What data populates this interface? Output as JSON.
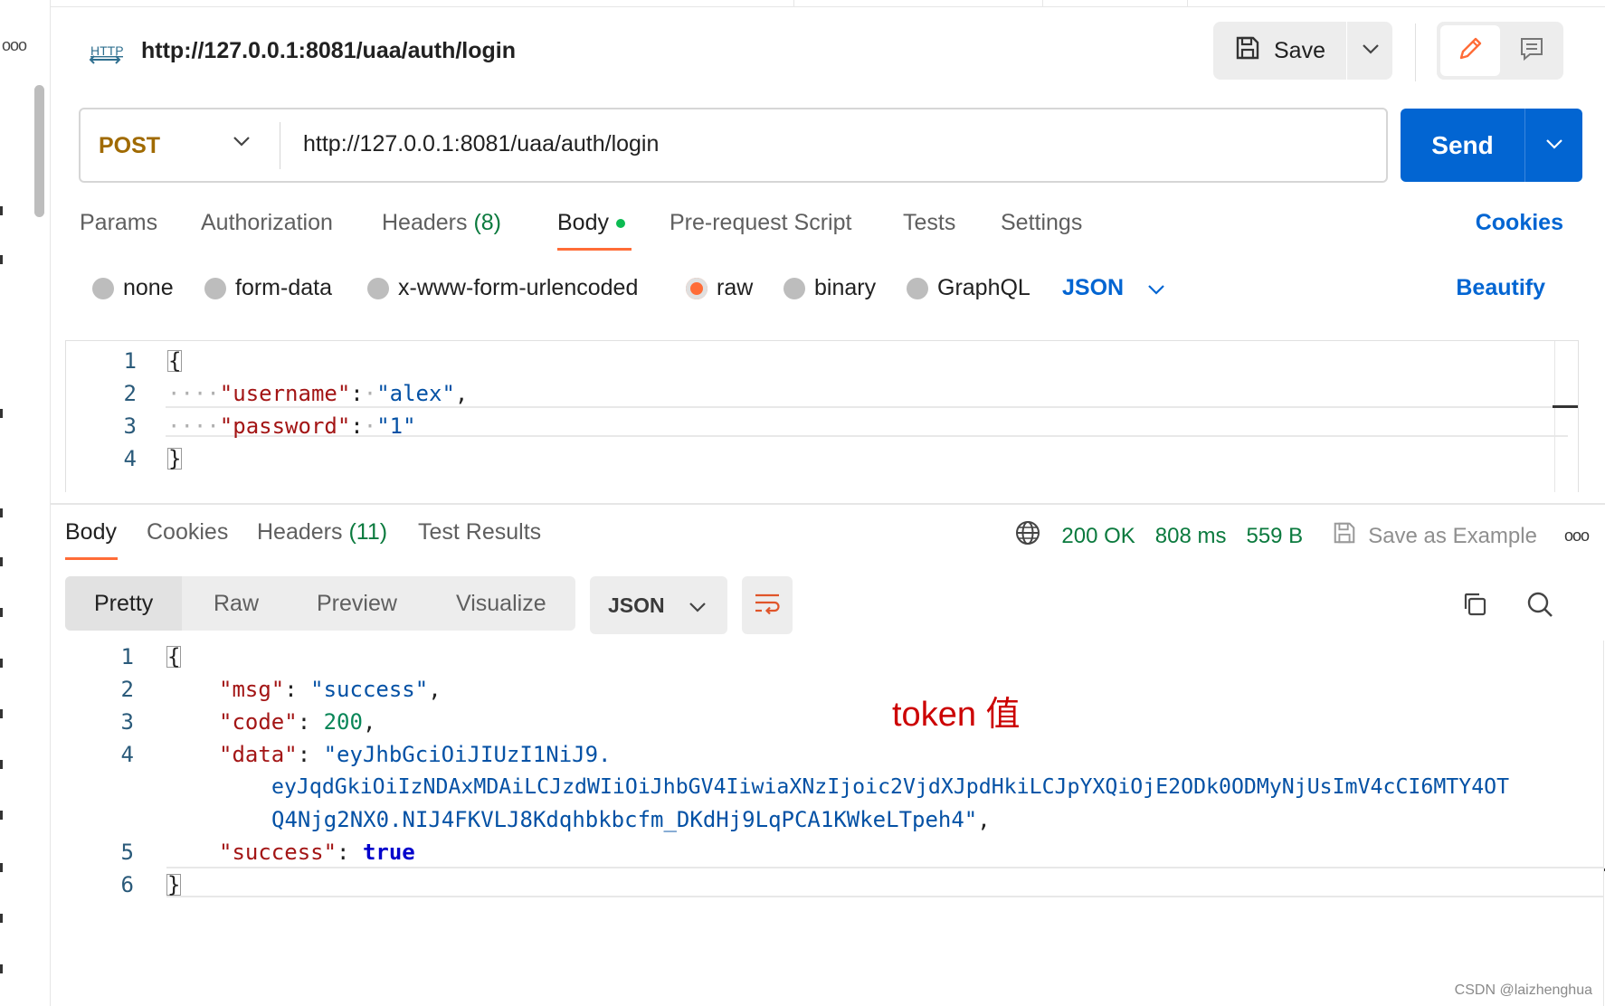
{
  "colors": {
    "accent_orange": "#ff6c37",
    "primary_blue": "#0265d2",
    "success_green": "#0b7a3e",
    "method_post": "#a06a00",
    "annotation_red": "#cc0000"
  },
  "sidebar": {
    "more_icon": "ellipsis-icon"
  },
  "header": {
    "protocol_icon": "http-icon",
    "title": "http://127.0.0.1:8081/uaa/auth/login",
    "save_label": "Save",
    "save_icon": "floppy-disk-icon",
    "edit_icon": "pencil-icon",
    "comment_icon": "comment-icon"
  },
  "request": {
    "method": "POST",
    "url": "http://127.0.0.1:8081/uaa/auth/login",
    "send_label": "Send"
  },
  "request_tabs": {
    "params": "Params",
    "authorization": "Authorization",
    "headers": "Headers",
    "headers_count": "(8)",
    "body": "Body",
    "pre_request": "Pre-request Script",
    "tests": "Tests",
    "settings": "Settings",
    "cookies": "Cookies"
  },
  "body_types": {
    "none": "none",
    "form_data": "form-data",
    "urlencoded": "x-www-form-urlencoded",
    "raw": "raw",
    "binary": "binary",
    "graphql": "GraphQL",
    "language": "JSON",
    "beautify": "Beautify",
    "selected": "raw"
  },
  "request_body": {
    "line_numbers": [
      "1",
      "2",
      "3",
      "4"
    ],
    "open_brace": "{",
    "close_brace": "}",
    "username_key": "\"username\"",
    "username_value": "\"alex\"",
    "password_key": "\"password\"",
    "password_value": "\"1\""
  },
  "response_tabs": {
    "body": "Body",
    "cookies": "Cookies",
    "headers": "Headers",
    "headers_count": "(11)",
    "test_results": "Test Results"
  },
  "response_status": {
    "status": "200 OK",
    "time": "808 ms",
    "size": "559 B",
    "save_example": "Save as Example"
  },
  "response_view": {
    "pretty": "Pretty",
    "raw": "Raw",
    "preview": "Preview",
    "visualize": "Visualize",
    "format": "JSON"
  },
  "response_body": {
    "line_numbers": [
      "1",
      "2",
      "3",
      "4",
      "5",
      "6"
    ],
    "open_brace": "{",
    "close_brace": "}",
    "msg_key": "\"msg\"",
    "msg_value": "\"success\"",
    "code_key": "\"code\"",
    "code_value": "200",
    "data_key": "\"data\"",
    "data_value_line1": "\"eyJhbGciOiJIUzI1NiJ9.",
    "data_value_line2": "eyJqdGkiOiIzNDAxMDAiLCJzdWIiOiJhbGV4IiwiaXNzIjoic2VjdXJpdHkiLCJpYXQiOjE2ODk0ODMyNjUsImV4cCI6MTY4OT",
    "data_value_line3": "Q4Njg2NX0.NIJ4FKVLJ8Kdqhbkbcfm_DKdHj9LqPCA1KWkeLTpeh4\"",
    "success_key": "\"success\"",
    "success_value": "true"
  },
  "annotation": "token 值",
  "watermark": "CSDN @laizhenghua"
}
